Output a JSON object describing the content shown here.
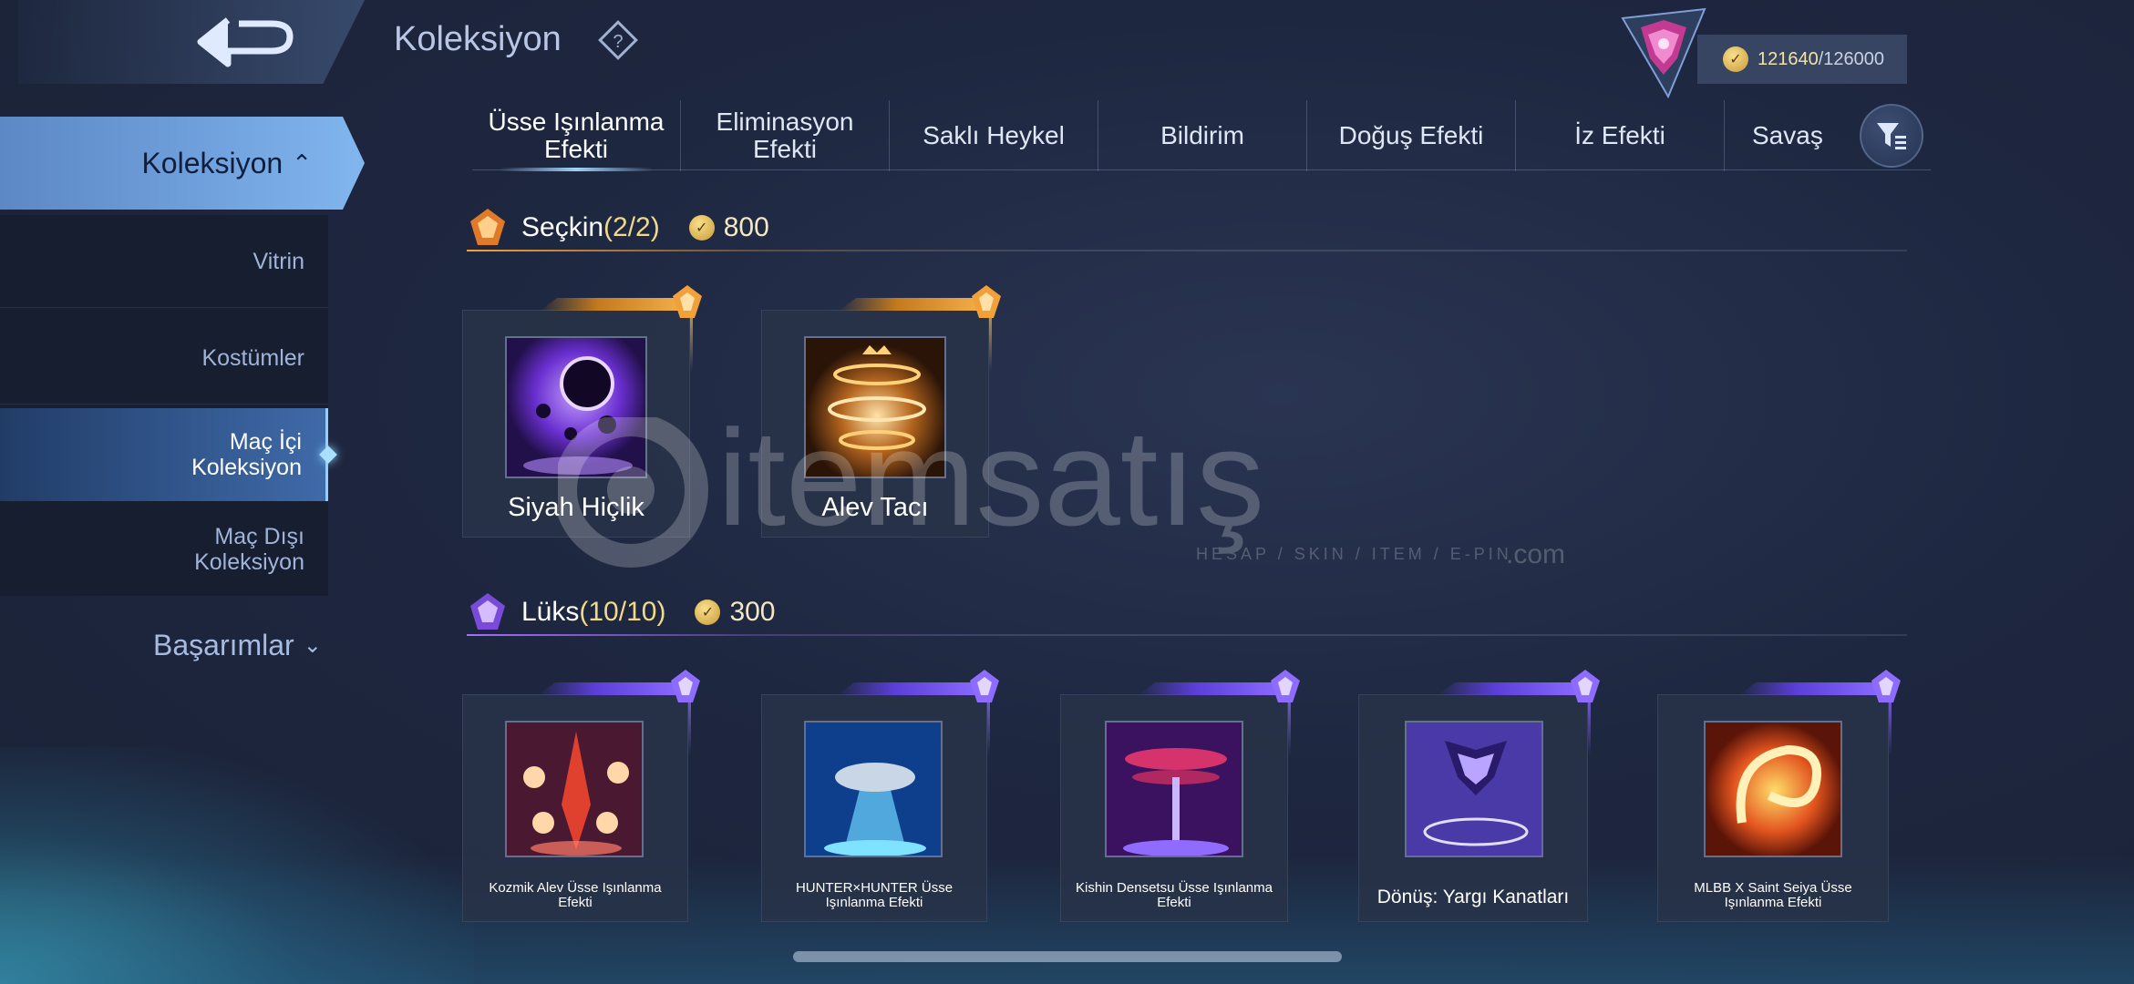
{
  "header": {
    "title": "Koleksiyon",
    "currency": {
      "value": "121640",
      "max": "/126000"
    }
  },
  "sidebar": {
    "main_label": "Koleksiyon",
    "items": [
      {
        "label": "Vitrin"
      },
      {
        "label": "Kostümler"
      },
      {
        "label": "Maç İçi Koleksiyon",
        "active": true
      },
      {
        "label": "Maç Dışı Koleksiyon"
      }
    ],
    "achievements_label": "Başarımlar"
  },
  "tabs": [
    {
      "label": "Üsse Işınlanma Efekti",
      "active": true
    },
    {
      "label": "Eliminasyon Efekti"
    },
    {
      "label": "Saklı Heykel"
    },
    {
      "label": "Bildirim"
    },
    {
      "label": "Doğuş Efekti"
    },
    {
      "label": "İz Efekti"
    },
    {
      "label": "Savaş"
    }
  ],
  "sections": [
    {
      "title": "Seçkin",
      "count": "(2/2)",
      "price": "800",
      "accent": "#f3a23c",
      "items": [
        {
          "name": "Siyah Hiçlik"
        },
        {
          "name": "Alev Tacı"
        }
      ]
    },
    {
      "title": "Lüks",
      "count": "(10/10)",
      "price": "300",
      "accent": "#a56cff",
      "items": [
        {
          "name": "Kozmik Alev Üsse Işınlanma Efekti"
        },
        {
          "name": "HUNTER×HUNTER Üsse Işınlanma Efekti"
        },
        {
          "name": "Kishin Densetsu Üsse Işınlanma Efekti"
        },
        {
          "name": "Dönüş: Yargı Kanatları"
        },
        {
          "name": "MLBB X Saint Seiya Üsse Işınlanma Efekti"
        }
      ]
    }
  ],
  "watermark": {
    "brand": "itemsatış",
    "tagline": "HESAP / SKIN / ITEM / E-PIN",
    "domain": ".com"
  },
  "icons": {
    "back": "back-arrow-icon",
    "help": "question-diamond-icon",
    "rank": "rank-badge-icon",
    "coin": "coin-icon",
    "filter": "filter-icon"
  }
}
